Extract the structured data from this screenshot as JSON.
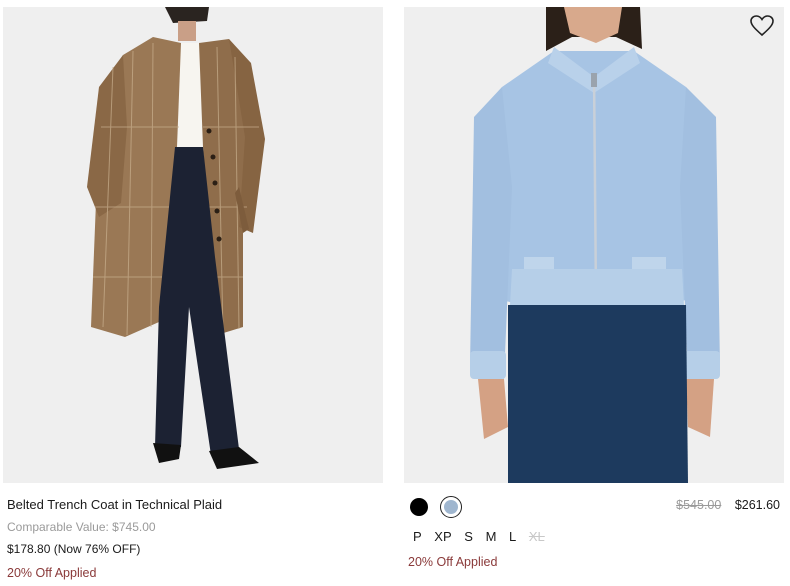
{
  "products": [
    {
      "title": "Belted Trench Coat in Technical Plaid",
      "comparable_value": "Comparable Value: $745.00",
      "now_price": "$178.80 (Now 76% OFF)",
      "promo": "20% Off Applied",
      "image_icon": "trench-coat-photo"
    },
    {
      "title": "",
      "original_price": "$545.00",
      "sale_price": "$261.60",
      "swatches": [
        {
          "name": "black",
          "color": "#000000"
        },
        {
          "name": "light-blue",
          "color": "#9fb6cf",
          "selected": true
        }
      ],
      "sizes": [
        {
          "label": "P",
          "available": true
        },
        {
          "label": "XP",
          "available": true
        },
        {
          "label": "S",
          "available": true
        },
        {
          "label": "M",
          "available": true
        },
        {
          "label": "L",
          "available": true
        },
        {
          "label": "XL",
          "available": false
        }
      ],
      "promo": "20% Off Applied",
      "wishlist_icon": "heart-icon",
      "image_icon": "bomber-jacket-photo"
    }
  ],
  "colors": {
    "promo": "#8a3a3a",
    "muted": "#9a9a9a",
    "image_bg": "#efefef"
  }
}
